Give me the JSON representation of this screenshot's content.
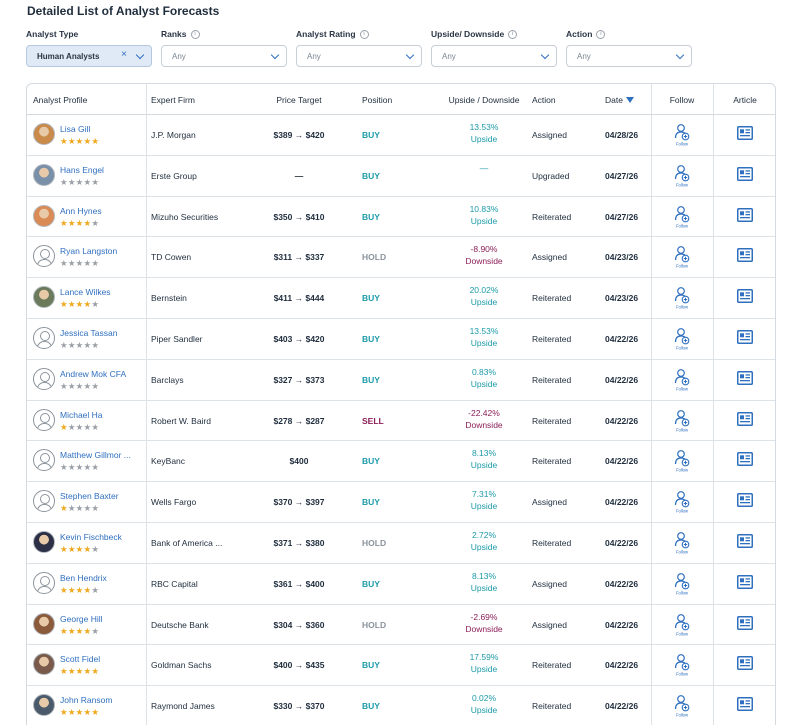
{
  "title": "Detailed List of Analyst Forecasts",
  "filters": [
    {
      "label": "Analyst Type",
      "value": "Human Analysts",
      "info": false,
      "clearable": true
    },
    {
      "label": "Ranks",
      "value": "Any",
      "info": true,
      "clearable": false
    },
    {
      "label": "Analyst Rating",
      "value": "Any",
      "info": true,
      "clearable": false
    },
    {
      "label": "Upside/ Downside",
      "value": "Any",
      "info": true,
      "clearable": false
    },
    {
      "label": "Action",
      "value": "Any",
      "info": true,
      "clearable": false
    }
  ],
  "columns": {
    "profile": "Analyst Profile",
    "firm": "Expert Firm",
    "target": "Price Target",
    "position": "Position",
    "updown": "Upside / Downside",
    "action": "Action",
    "date": "Date",
    "follow": "Follow",
    "article": "Article"
  },
  "follow_label": "Follow",
  "colors": {
    "accent": "#2f6fbf",
    "buy": "#1c9aa8",
    "sell": "#8b1e57",
    "hold": "#8a939d",
    "star": "#f0a81c"
  },
  "rows": [
    {
      "name": "Lisa Gill",
      "stars": 4.5,
      "avatar": "photo",
      "avatar_color": "#c98a4a",
      "firm": "J.P. Morgan",
      "target": "$389 → $420",
      "position": "BUY",
      "pct": "13.53%",
      "dir": "Upside",
      "action": "Assigned",
      "date": "04/28/26"
    },
    {
      "name": "Hans Engel",
      "stars": 0,
      "avatar": "photo",
      "avatar_color": "#7a8fa8",
      "firm": "Erste Group",
      "target": "—",
      "position": "BUY",
      "pct": "—",
      "dir": "",
      "action": "Upgraded",
      "date": "04/27/26"
    },
    {
      "name": "Ann Hynes",
      "stars": 4,
      "avatar": "photo",
      "avatar_color": "#d98a55",
      "firm": "Mizuho Securities",
      "target": "$350 → $410",
      "position": "BUY",
      "pct": "10.83%",
      "dir": "Upside",
      "action": "Reiterated",
      "date": "04/27/26"
    },
    {
      "name": "Ryan Langston",
      "stars": 0,
      "avatar": "placeholder",
      "avatar_color": "",
      "firm": "TD Cowen",
      "target": "$311 → $337",
      "position": "HOLD",
      "pct": "-8.90%",
      "dir": "Downside",
      "action": "Assigned",
      "date": "04/23/26"
    },
    {
      "name": "Lance Wilkes",
      "stars": 4,
      "avatar": "photo",
      "avatar_color": "#6a7a5a",
      "firm": "Bernstein",
      "target": "$411 → $444",
      "position": "BUY",
      "pct": "20.02%",
      "dir": "Upside",
      "action": "Reiterated",
      "date": "04/23/26"
    },
    {
      "name": "Jessica Tassan",
      "stars": 0,
      "avatar": "placeholder",
      "avatar_color": "",
      "firm": "Piper Sandler",
      "target": "$403 → $420",
      "position": "BUY",
      "pct": "13.53%",
      "dir": "Upside",
      "action": "Reiterated",
      "date": "04/22/26"
    },
    {
      "name": "Andrew Mok CFA",
      "stars": 0,
      "avatar": "placeholder",
      "avatar_color": "",
      "firm": "Barclays",
      "target": "$327 → $373",
      "position": "BUY",
      "pct": "0.83%",
      "dir": "Upside",
      "action": "Reiterated",
      "date": "04/22/26"
    },
    {
      "name": "Michael Ha",
      "stars": 1,
      "avatar": "placeholder",
      "avatar_color": "",
      "firm": "Robert W. Baird",
      "target": "$278 → $287",
      "position": "SELL",
      "pct": "-22.42%",
      "dir": "Downside",
      "action": "Reiterated",
      "date": "04/22/26"
    },
    {
      "name": "Matthew Gillmor ...",
      "stars": 0,
      "avatar": "placeholder",
      "avatar_color": "",
      "firm": "KeyBanc",
      "target": "$400",
      "position": "BUY",
      "pct": "8.13%",
      "dir": "Upside",
      "action": "Reiterated",
      "date": "04/22/26"
    },
    {
      "name": "Stephen Baxter",
      "stars": 1,
      "avatar": "placeholder",
      "avatar_color": "",
      "firm": "Wells Fargo",
      "target": "$370 → $397",
      "position": "BUY",
      "pct": "7.31%",
      "dir": "Upside",
      "action": "Assigned",
      "date": "04/22/26"
    },
    {
      "name": "Kevin Fischbeck",
      "stars": 4,
      "avatar": "photo",
      "avatar_color": "#2c2f45",
      "firm": "Bank of America ...",
      "target": "$371 → $380",
      "position": "HOLD",
      "pct": "2.72%",
      "dir": "Upside",
      "action": "Reiterated",
      "date": "04/22/26"
    },
    {
      "name": "Ben Hendrix",
      "stars": 4,
      "avatar": "placeholder",
      "avatar_color": "",
      "firm": "RBC Capital",
      "target": "$361 → $400",
      "position": "BUY",
      "pct": "8.13%",
      "dir": "Upside",
      "action": "Assigned",
      "date": "04/22/26"
    },
    {
      "name": "George Hill",
      "stars": 4,
      "avatar": "photo",
      "avatar_color": "#8a5a3a",
      "firm": "Deutsche Bank",
      "target": "$304 → $360",
      "position": "HOLD",
      "pct": "-2.69%",
      "dir": "Downside",
      "action": "Assigned",
      "date": "04/22/26"
    },
    {
      "name": "Scott Fidel",
      "stars": 5,
      "avatar": "photo",
      "avatar_color": "#7a5a4a",
      "firm": "Goldman Sachs",
      "target": "$400 → $435",
      "position": "BUY",
      "pct": "17.59%",
      "dir": "Upside",
      "action": "Reiterated",
      "date": "04/22/26"
    },
    {
      "name": "John Ransom",
      "stars": 5,
      "avatar": "photo",
      "avatar_color": "#4a5a6a",
      "firm": "Raymond James",
      "target": "$330 → $370",
      "position": "BUY",
      "pct": "0.02%",
      "dir": "Upside",
      "action": "Reiterated",
      "date": "04/22/26"
    }
  ]
}
